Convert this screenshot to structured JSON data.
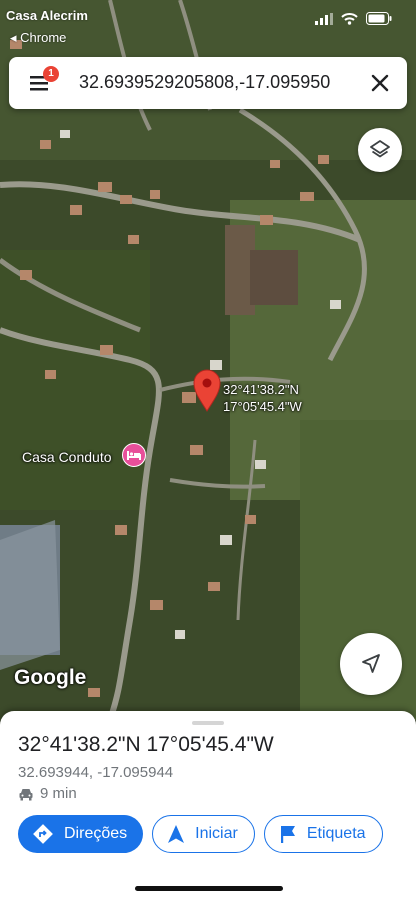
{
  "status_bar": {
    "carrier": "Casa Alecrim",
    "back_app": "◂ Chrome"
  },
  "search": {
    "query": "32.6939529205808,-17.095950",
    "badge_count": "1"
  },
  "map": {
    "pin_label_line1": "32°41'38.2\"N",
    "pin_label_line2": "17°05'45.4\"W",
    "poi_label": "Casa Conduto",
    "logo": "Google",
    "pin_color": "#ea4335",
    "poi_color": "#e84f9a"
  },
  "place_sheet": {
    "title": "32°41'38.2\"N 17°05'45.4\"W",
    "coordinates": "32.693944, -17.095944",
    "drive_time": "9 min",
    "actions": {
      "directions": "Direções",
      "start": "Iniciar",
      "label": "Etiqueta"
    }
  },
  "colors": {
    "accent": "#1a73e8"
  },
  "icons": [
    "menu-icon",
    "close-icon",
    "layers-icon",
    "location-arrow-icon",
    "map-pin-icon",
    "hotel-bed-icon",
    "car-icon",
    "directions-icon",
    "navigation-arrow-icon",
    "flag-icon"
  ]
}
